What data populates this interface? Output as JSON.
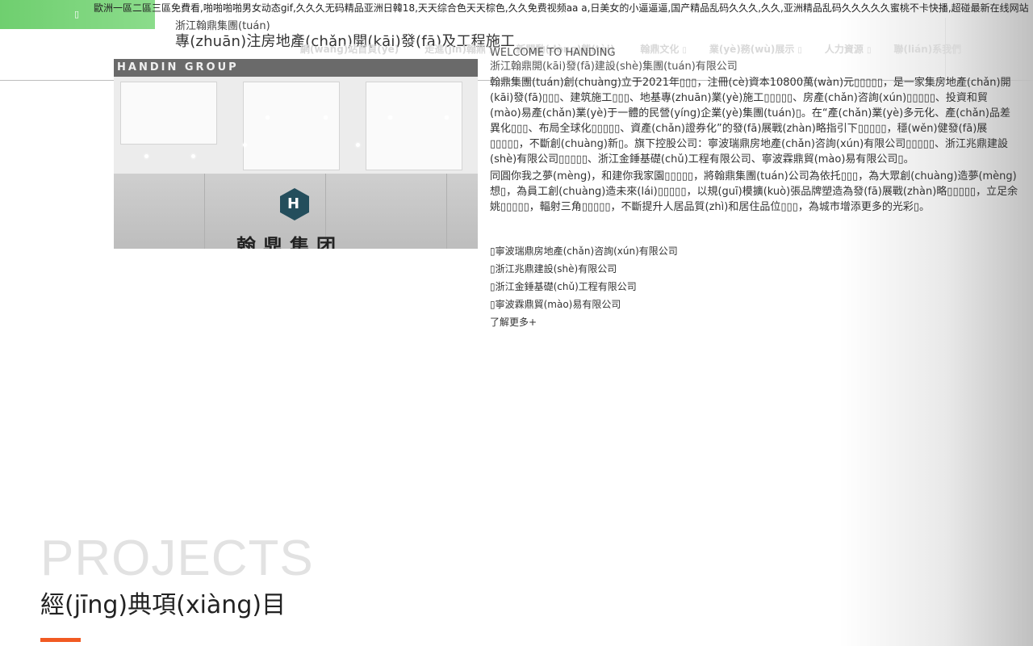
{
  "top_strip": {
    "box_glyph": "▯",
    "text": "歐洲一區二區三區免費看,啪啪啪啪男女动态gif,久久久无码精品亚洲日韓18,天天综合色天天棕色,久久免费视频aa a,日美女的小逼逼逼,国产精品乱码久久久,久久,亚洲精品乱码久久久久久蜜桃不卡快播,超碰最新在线网站"
  },
  "header": {
    "brand_name": "浙江翰鼎集團(tuán)",
    "slogan": "專(zhuān)注房地產(chǎn)開(kāi)發(fā)及工程施工",
    "nav": [
      {
        "label": "網(wǎng)站首頁(yè)",
        "caret": ""
      },
      {
        "label": "走進(jìn)翰鼎",
        "caret": "▯"
      },
      {
        "label": "新聞動(dòng)態(tài)",
        "caret": ""
      },
      {
        "label": "翰鼎文化",
        "caret": "▯"
      },
      {
        "label": "業(yè)務(wù)展示",
        "caret": "▯"
      },
      {
        "label": "人力資源",
        "caret": "▯"
      },
      {
        "label": "聯(lián)系我們",
        "caret": ""
      }
    ]
  },
  "photo": {
    "brand_en": "HANDIN GROUP",
    "wall_text": "翰鼎集团",
    "logo_glyph": "H"
  },
  "about": {
    "welcome": "WELCOME TO HANDING",
    "company": "浙江翰鼎開(kāi)發(fā)建設(shè)集團(tuán)有限公司",
    "para1": "翰鼎集團(tuán)創(chuàng)立于2021年▯▯▯，注冊(cè)資本10800萬(wàn)元▯▯▯▯▯，是一家集房地產(chǎn)開(kāi)發(fā)▯▯▯、建筑施工▯▯▯、地基專(zhuān)業(yè)施工▯▯▯▯▯、房產(chǎn)咨詢(xún)▯▯▯▯▯、投資和貿(mào)易產(chǎn)業(yè)于一體的民營(yíng)企業(yè)集團(tuán)▯。在“產(chǎn)業(yè)多元化、產(chǎn)品差異化▯▯▯、布局全球化▯▯▯▯▯、資產(chǎn)證券化”的發(fā)展戰(zhàn)略指引下▯▯▯▯▯，穩(wěn)健發(fā)展▯▯▯▯▯，不斷創(chuàng)新▯。旗下控股公司：寧波瑞鼎房地產(chǎn)咨詢(xún)有限公司▯▯▯▯▯、浙江兆鼎建設(shè)有限公司▯▯▯▯▯、浙江金錘基礎(chǔ)工程有限公司、寧波霖鼎貿(mào)易有限公司▯。",
    "para2": "同圓你我之夢(mèng)，和建你我家園▯▯▯▯▯，將翰鼎集團(tuán)公司為依托▯▯▯，為大眾創(chuàng)造夢(mèng)想▯，為員工創(chuàng)造未來(lái)▯▯▯▯▯，以規(guī)模擴(kuò)張品牌塑造為發(fā)展戰(zhàn)略▯▯▯▯▯，立足余姚▯▯▯▯▯，輻射三角▯▯▯▯▯，不斷提升人居品質(zhì)和居住品位▯▯▯，為城市增添更多的光彩▯。"
  },
  "subsidiaries": [
    "▯寧波瑞鼎房地產(chǎn)咨詢(xún)有限公司",
    "▯浙江兆鼎建設(shè)有限公司",
    "▯浙江金錘基礎(chǔ)工程有限公司",
    "▯寧波霖鼎貿(mào)易有限公司"
  ],
  "more_label": "了解更多+",
  "projects": {
    "title_en": "PROJECTS",
    "title_zh": "經(jīng)典項(xiàng)目"
  },
  "colors": {
    "accent": "#f15a22",
    "green_bar": "#7ed67e"
  }
}
